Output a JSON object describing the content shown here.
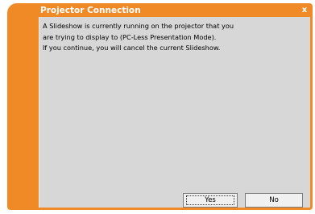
{
  "window": {
    "title": "Projector Connection",
    "close_glyph": "x"
  },
  "message": {
    "line1": "A Slideshow is currently running on the projector that you",
    "line2": "are trying to display to (PC-Less Presentation Mode).",
    "line3": "If you continue, you will cancel the current Slideshow."
  },
  "buttons": {
    "yes_label": "Yes",
    "no_label": "No"
  },
  "colors": {
    "frame": "#f08a26",
    "content_bg": "#d7d7d7",
    "title_text": "#ffffff"
  }
}
